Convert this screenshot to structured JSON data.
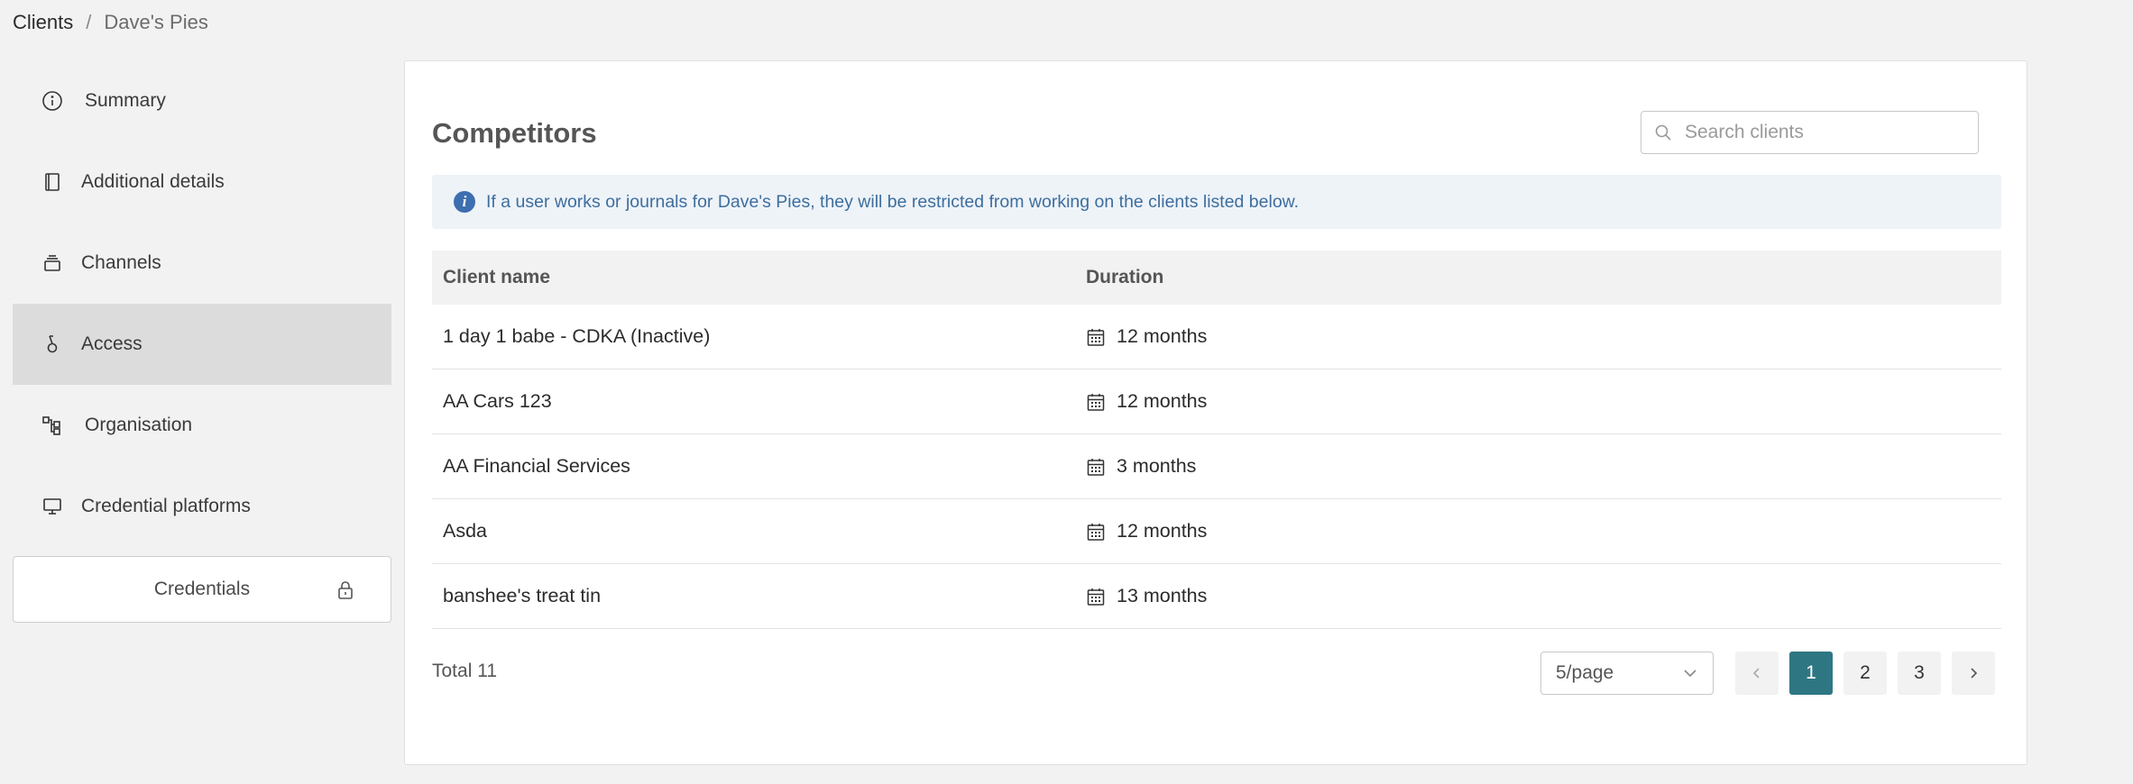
{
  "breadcrumb": {
    "root": "Clients",
    "separator": "/",
    "current": "Dave's Pies"
  },
  "sidebar": {
    "items": [
      {
        "label": "Summary",
        "icon": "info-circle-icon"
      },
      {
        "label": "Additional details",
        "icon": "book-icon"
      },
      {
        "label": "Channels",
        "icon": "stack-icon"
      },
      {
        "label": "Access",
        "icon": "key-icon",
        "active": true
      },
      {
        "label": "Organisation",
        "icon": "org-chart-icon"
      },
      {
        "label": "Credential platforms",
        "icon": "monitor-icon"
      }
    ],
    "credentials_button": {
      "label": "Credentials",
      "icon": "lock-icon"
    }
  },
  "panel": {
    "title": "Competitors",
    "search": {
      "placeholder": "Search clients",
      "value": ""
    },
    "info": "If a user works or journals for Dave's Pies, they will be restricted from working on the clients listed below.",
    "table": {
      "columns": [
        "Client name",
        "Duration"
      ],
      "rows": [
        {
          "client": "1 day 1 babe - CDKA (Inactive)",
          "duration": "12 months"
        },
        {
          "client": "AA Cars 123",
          "duration": "12 months"
        },
        {
          "client": "AA Financial Services",
          "duration": "3 months"
        },
        {
          "client": "Asda",
          "duration": "12 months"
        },
        {
          "client": "banshee's treat tin",
          "duration": "13 months"
        }
      ]
    },
    "pagination": {
      "total": "Total 11",
      "page_size": "5/page",
      "pages": [
        "1",
        "2",
        "3"
      ],
      "current_page": "1"
    }
  },
  "colors": {
    "accent": "#2f7683",
    "info_text": "#3d6e9e",
    "info_bg": "#eef3f8",
    "active_nav": "#dcdcdc"
  }
}
